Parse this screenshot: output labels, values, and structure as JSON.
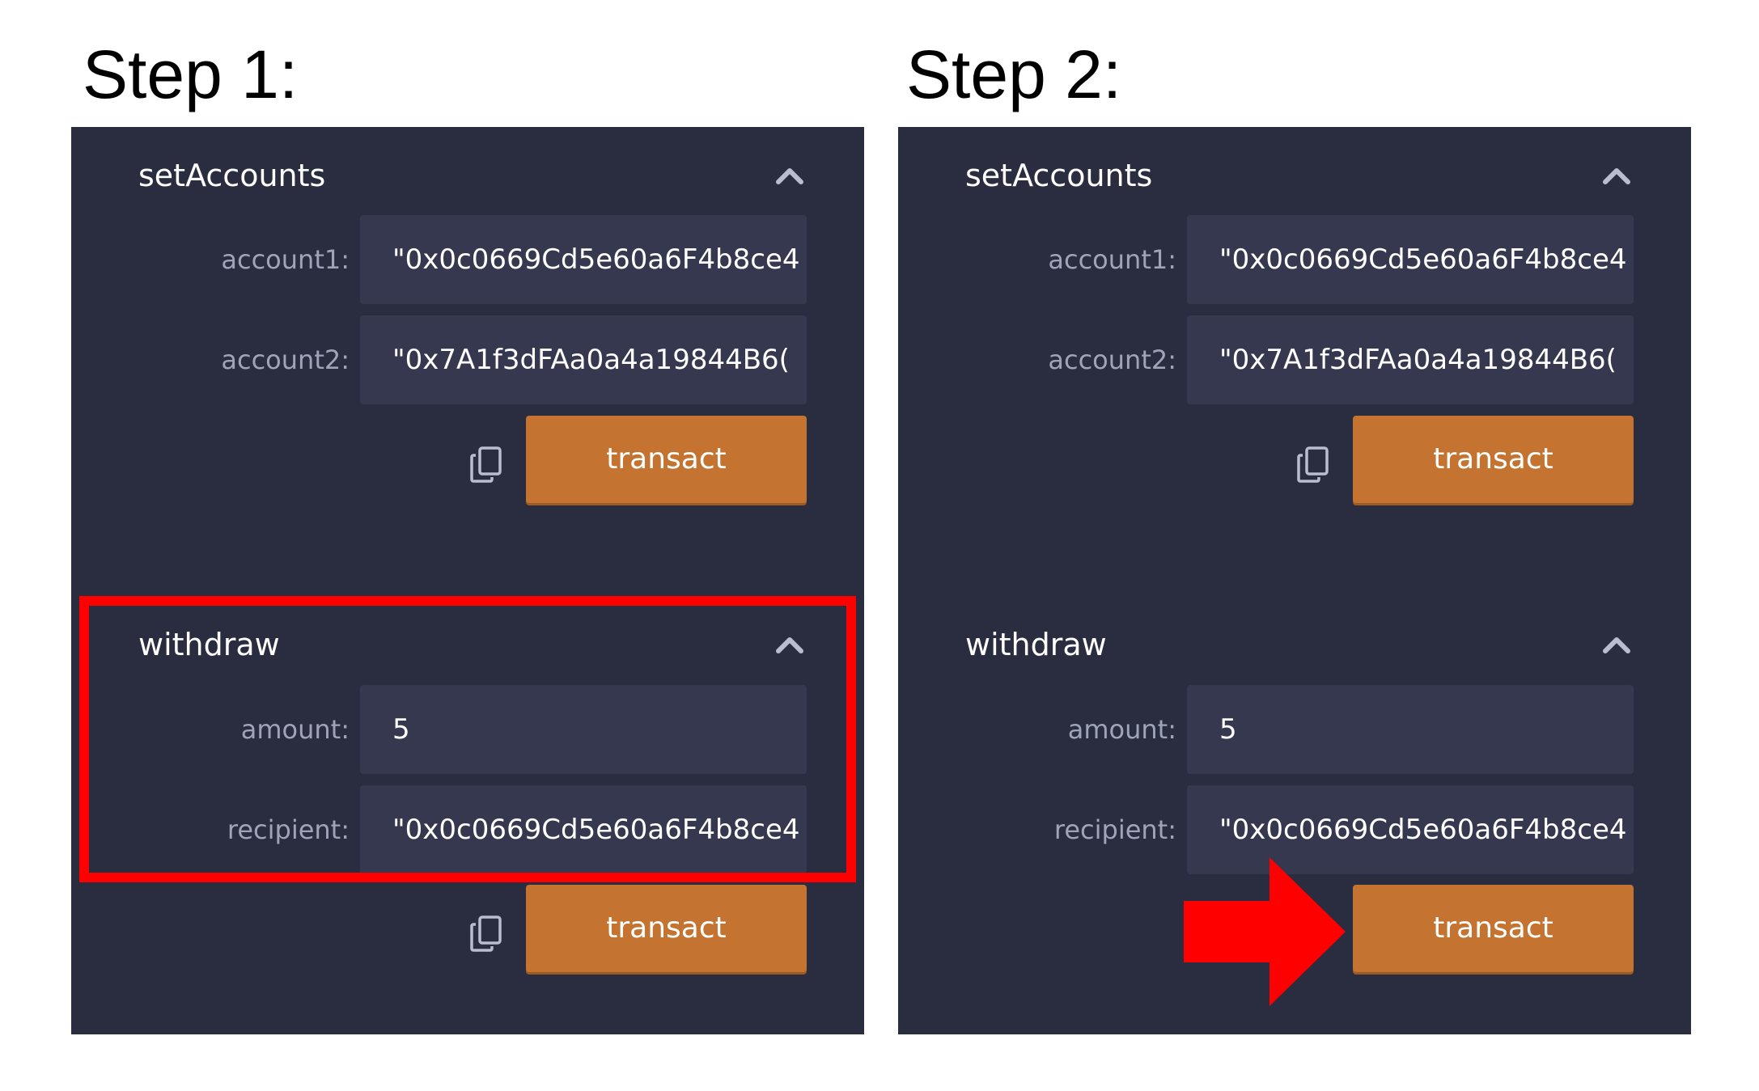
{
  "steps": [
    {
      "title": "Step 1:",
      "sections": {
        "set_accounts": {
          "title": "setAccounts",
          "fields": [
            {
              "label": "account1:",
              "value": "\"0x0c0669Cd5e60a6F4b8ce4"
            },
            {
              "label": "account2:",
              "value": "\"0x7A1f3dFAa0a4a19844B6("
            }
          ],
          "button_label": "transact"
        },
        "withdraw": {
          "title": "withdraw",
          "fields": [
            {
              "label": "amount:",
              "value": "5"
            },
            {
              "label": "recipient:",
              "value": "\"0x0c0669Cd5e60a6F4b8ce4"
            }
          ],
          "button_label": "transact"
        }
      },
      "annotation": "red-highlight-box-around-withdraw"
    },
    {
      "title": "Step 2:",
      "sections": {
        "set_accounts": {
          "title": "setAccounts",
          "fields": [
            {
              "label": "account1:",
              "value": "\"0x0c0669Cd5e60a6F4b8ce4"
            },
            {
              "label": "account2:",
              "value": "\"0x7A1f3dFAa0a4a19844B6("
            }
          ],
          "button_label": "transact"
        },
        "withdraw": {
          "title": "withdraw",
          "fields": [
            {
              "label": "amount:",
              "value": "5"
            },
            {
              "label": "recipient:",
              "value": "\"0x0c0669Cd5e60a6F4b8ce4"
            }
          ],
          "button_label": "transact"
        }
      },
      "annotation": "red-arrow-pointing-to-withdraw-transact"
    }
  ],
  "icons": {
    "collapse": "chevron-up-icon",
    "copy": "copy-icon",
    "arrow": "right-arrow-icon"
  },
  "colors": {
    "panel_bg": "#2a2c3f",
    "input_bg": "#35384e",
    "button": "#c47430",
    "label": "#9fa4b8",
    "annotation": "#ff0000"
  }
}
